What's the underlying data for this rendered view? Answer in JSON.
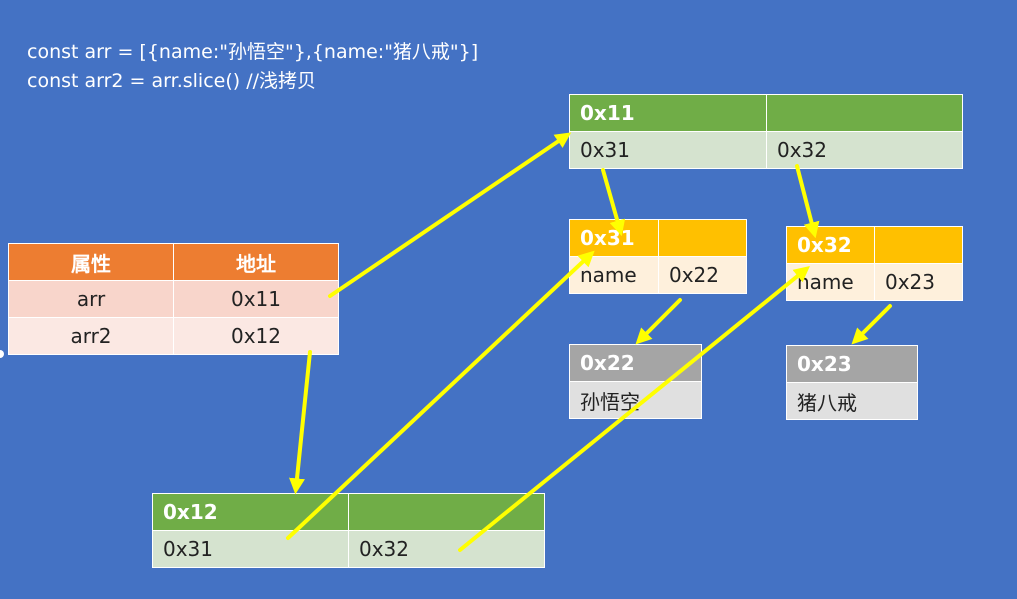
{
  "code": {
    "line1": "const arr = [{name:\"孙悟空\"},{name:\"猪八戒\"}]",
    "line2": "const arr2 = arr.slice() //浅拷贝"
  },
  "prop_table": {
    "headers": [
      "属性",
      "地址"
    ],
    "rows": [
      {
        "prop": "arr",
        "addr": "0x11"
      },
      {
        "prop": "arr2",
        "addr": "0x12"
      }
    ]
  },
  "arr_0x11": {
    "title": "0x11",
    "cells": [
      "0x31",
      "0x32"
    ]
  },
  "arr_0x12": {
    "title": "0x12",
    "cells": [
      "0x31",
      "0x32"
    ]
  },
  "obj_0x31": {
    "title": "0x31",
    "key": "name",
    "value": "0x22"
  },
  "obj_0x32": {
    "title": "0x32",
    "key": "name",
    "value": "0x23"
  },
  "str_0x22": {
    "title": "0x22",
    "value": "孙悟空"
  },
  "str_0x23": {
    "title": "0x23",
    "value": "猪八戒"
  },
  "colors": {
    "background": "#4472C4",
    "arrow": "#FFFF00",
    "array_header": "#70AD47",
    "object_header": "#FFC000",
    "string_header": "#A5A5A5",
    "prop_header": "#ED7D31"
  }
}
